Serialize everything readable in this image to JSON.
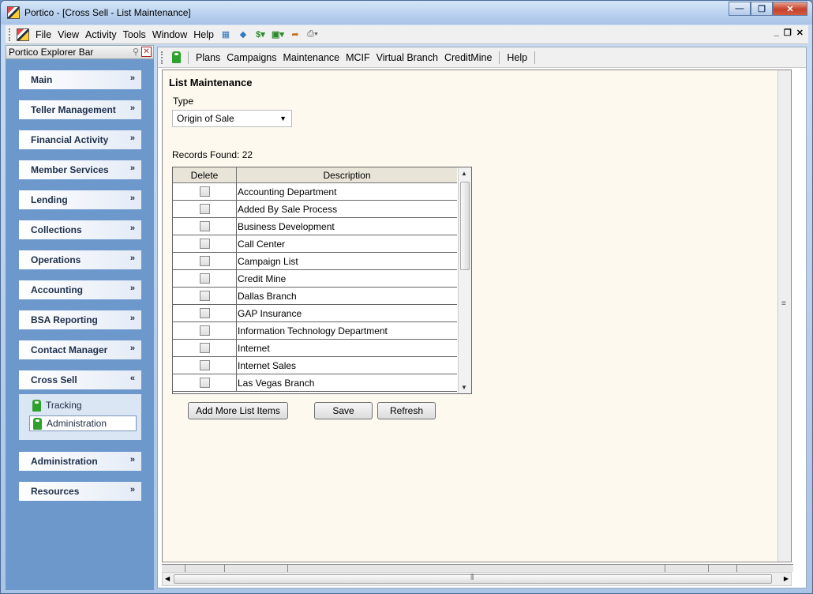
{
  "window": {
    "title": "Portico - [Cross Sell - List Maintenance]"
  },
  "menu": {
    "items": [
      "File",
      "View",
      "Activity",
      "Tools",
      "Window",
      "Help"
    ]
  },
  "explorer": {
    "title": "Portico Explorer Bar",
    "groups": [
      "Main",
      "Teller Management",
      "Financial Activity",
      "Member Services",
      "Lending",
      "Collections",
      "Operations",
      "Accounting",
      "BSA Reporting",
      "Contact Manager",
      "Cross Sell",
      "Administration",
      "Resources"
    ],
    "cross_sell_items": [
      "Tracking",
      "Administration"
    ],
    "selected_item": "Administration"
  },
  "toolbar": {
    "items": [
      "Plans",
      "Campaigns",
      "Maintenance",
      "MCIF",
      "Virtual Branch",
      "CreditMine",
      "Help"
    ]
  },
  "page": {
    "title": "List Maintenance",
    "type_label": "Type",
    "type_value": "Origin of Sale",
    "records_label": "Records Found:",
    "records_count": "22"
  },
  "grid": {
    "headers": {
      "delete": "Delete",
      "description": "Description"
    },
    "rows": [
      "Accounting Department",
      "Added By Sale Process",
      "Business Development",
      "Call Center",
      "Campaign List",
      "Credit Mine",
      "Dallas Branch",
      "GAP Insurance",
      "Information Technology Department",
      "Internet",
      "Internet Sales",
      "Las Vegas Branch"
    ]
  },
  "buttons": {
    "add": "Add More List Items",
    "save": "Save",
    "refresh": "Refresh"
  }
}
